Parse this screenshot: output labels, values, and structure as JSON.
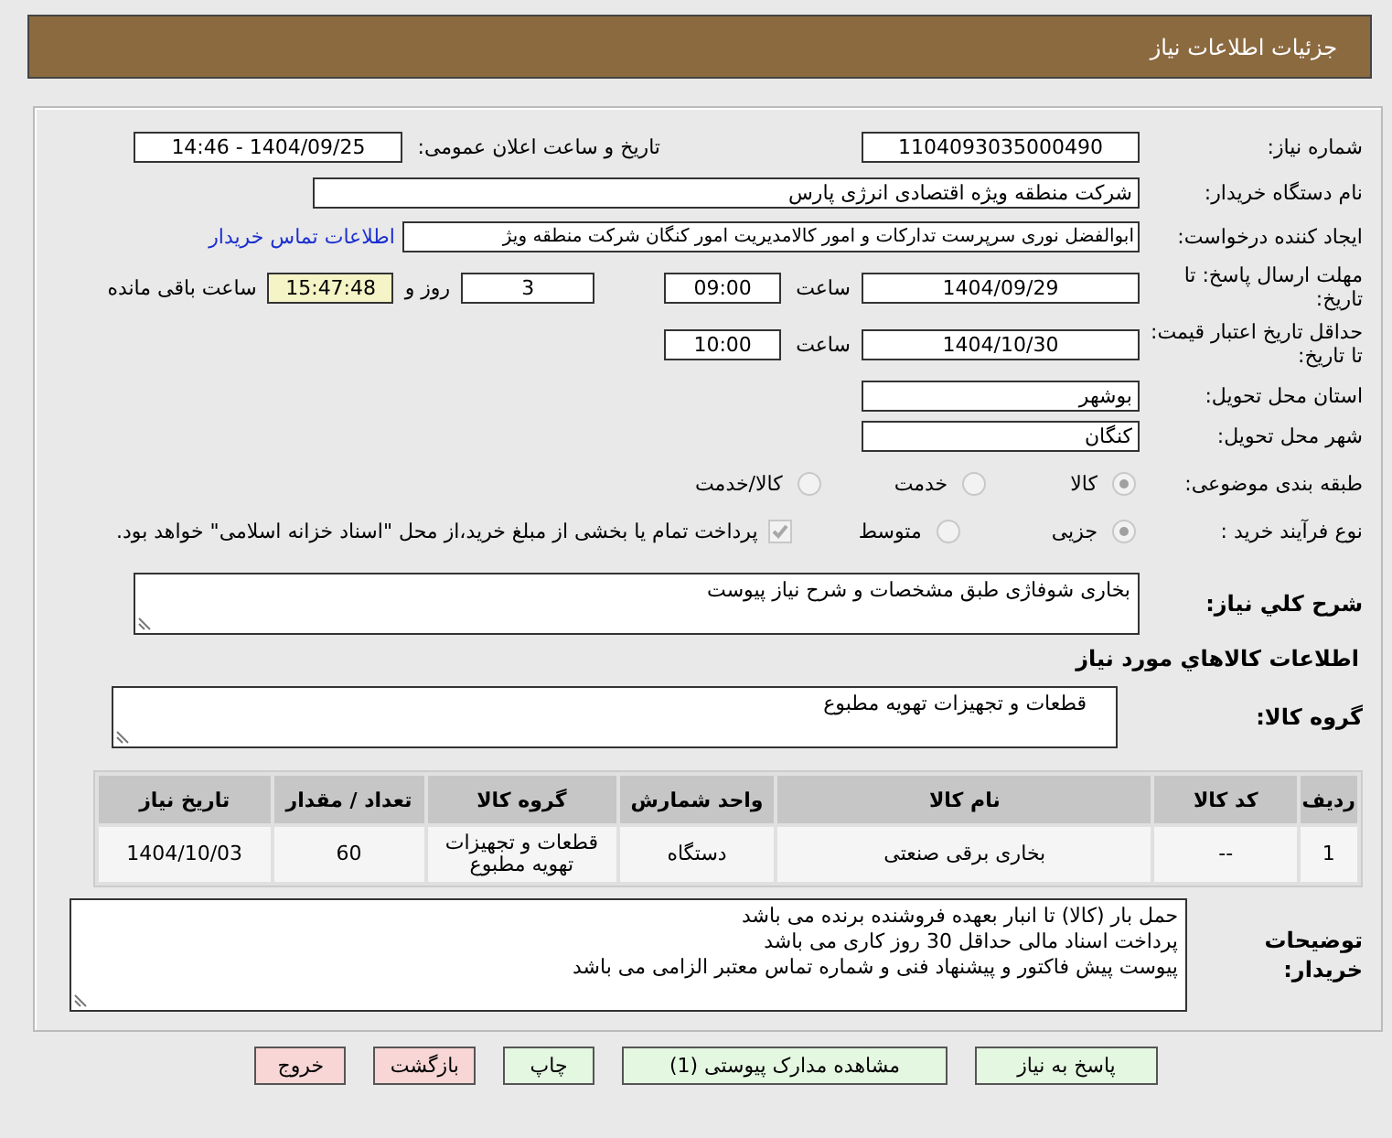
{
  "title": "جزئیات اطلاعات نیاز",
  "need_number": {
    "label": "شماره نیاز:",
    "value": "1104093035000490"
  },
  "announce": {
    "label": "تاریخ و ساعت اعلان عمومی:",
    "value": "1404/09/25 - 14:46"
  },
  "buyer": {
    "label": "نام دستگاه خریدار:",
    "value": "شرکت منطقه ویژه اقتصادی انرژی پارس"
  },
  "requester": {
    "label": "ایجاد کننده درخواست:",
    "value": "ابوالفضل نوری سرپرست تدارکات و امور کالامدیریت امور کنگان شرکت منطقه ویژ",
    "link": "اطلاعات تماس خریدار"
  },
  "deadline": {
    "label": "مهلت ارسال پاسخ: تا تاریخ:",
    "date": "1404/09/29",
    "time_label": "ساعت",
    "time": "09:00",
    "days": "3",
    "days_label": "روز و",
    "remaining": "15:47:48",
    "remaining_label": "ساعت باقی مانده"
  },
  "validity": {
    "label": "حداقل تاریخ اعتبار قیمت: تا تاریخ:",
    "date": "1404/10/30",
    "time_label": "ساعت",
    "time": "10:00"
  },
  "province": {
    "label": "استان محل تحویل:",
    "value": "بوشهر"
  },
  "city": {
    "label": "شهر محل تحویل:",
    "value": "کنگان"
  },
  "category": {
    "label": "طبقه بندی موضوعی:",
    "options": [
      {
        "label": "کالا",
        "selected": true
      },
      {
        "label": "خدمت",
        "selected": false
      },
      {
        "label": "کالا/خدمت",
        "selected": false
      }
    ]
  },
  "purchase_process": {
    "label": "نوع فرآیند خرید :",
    "options": [
      {
        "label": "جزیی",
        "selected": true
      },
      {
        "label": "متوسط",
        "selected": false
      }
    ],
    "payment_note": {
      "checked": true,
      "text": "پرداخت تمام یا بخشی از مبلغ خرید،از محل \"اسناد خزانه اسلامی\" خواهد بود."
    }
  },
  "description": {
    "label": "شرح کلي نياز:",
    "value": "بخاری شوفاژی طبق مشخصات و شرح نیاز پیوست"
  },
  "goods_heading": "اطلاعات کالاهاي مورد نياز",
  "goods_group": {
    "label": "گروه کالا:",
    "value": "قطعات و تجهیزات تهویه مطبوع"
  },
  "table": {
    "columns": [
      "ردیف",
      "کد کالا",
      "نام کالا",
      "واحد شمارش",
      "گروه کالا",
      "تعداد / مقدار",
      "تاریخ نیاز"
    ],
    "rows": [
      [
        "1",
        "--",
        "بخاری برقی صنعتی",
        "دستگاه",
        "قطعات و تجهیزات تهویه مطبوع",
        "60",
        "1404/10/03"
      ]
    ]
  },
  "buyer_notes": {
    "label": "توضیحات خریدار:",
    "lines": [
      "حمل بار (کالا)  تا انبار بعهده فروشنده برنده می باشد",
      "پرداخت اسناد مالی حداقل 30 روز کاری می باشد",
      "پیوست پیش فاکتور و پیشنهاد فنی  و شماره تماس معتبر  الزامی می باشد"
    ]
  },
  "buttons": [
    {
      "label": "پاسخ به نیاز",
      "kind": "action"
    },
    {
      "label": "مشاهده مدارک پیوستی (1)",
      "kind": "action"
    },
    {
      "label": "چاپ",
      "kind": "action"
    },
    {
      "label": "بازگشت",
      "kind": "exit"
    },
    {
      "label": "خروج",
      "kind": "exit"
    }
  ]
}
